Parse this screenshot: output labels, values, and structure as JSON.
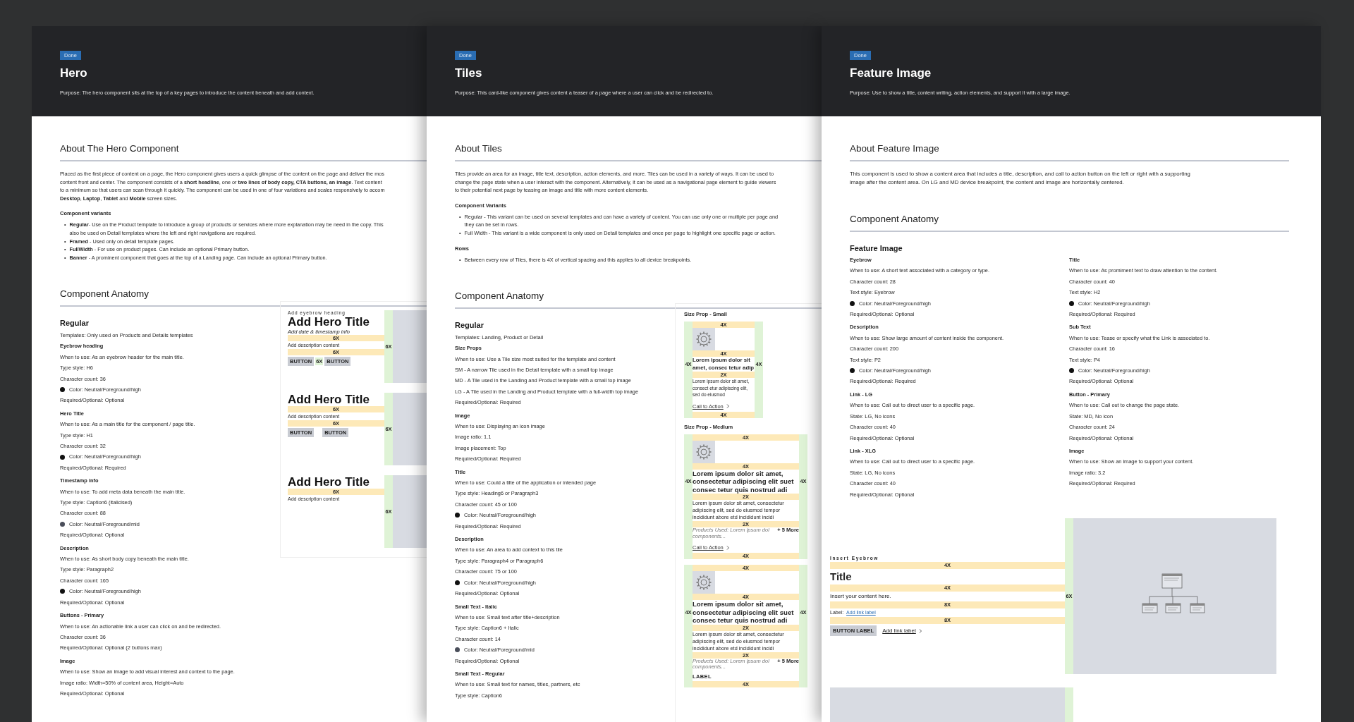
{
  "pages": [
    {
      "status": "Done",
      "title": "Hero",
      "purpose": "Purpose: The hero component sits at the top of a key pages to introduce the content beneath and add context.",
      "about": {
        "heading": "About The Hero Component",
        "lines": [
          "Placed as the first piece of content on a page, the Hero component gives users a quick glimpse of the content on the page and deliver the mos",
          "content front and center. The component consists of a **short headline**, one or **two lines of body copy, CTA buttons, an image**. Text content",
          "to a minimum so that users can scan through it quickly. The component can be used in one of four variations and scales responsively to accom",
          "**Desktop**, **Laptop**, **Tablet** and **Mobile** screen sizes."
        ],
        "groups": [
          {
            "heading": "Component variants",
            "bullets": [
              {
                "marker": "•",
                "lines": [
                  "**Regular**- Use on the Product template to introduce a group of products or services where more explanation may be need in the copy. This",
                  "also be used on Detail templates where the left and right navigations are required."
                ]
              },
              {
                "marker": "•",
                "lines": [
                  "**Framed** - Used only on detail template pages."
                ]
              },
              {
                "marker": "•",
                "lines": [
                  "**FullWidth** - For use on product pages. Can include an optional Primary button."
                ]
              },
              {
                "marker": "•",
                "lines": [
                  "**Banner** - A prominent component that goes at the top of a Landing page. Can include an optional Primary button."
                ]
              }
            ]
          }
        ]
      },
      "anatomy": {
        "heading": "Component Anatomy",
        "subheading": "Regular",
        "templates": "Templates: Only used on Products and Details templates",
        "columns": [
          [
            {
              "label": "Eyebrow heading",
              "lines": [
                {
                  "text": "When to use: As an eyebrow header for the main title."
                },
                {
                  "text": "Type style: H6"
                },
                {
                  "text": "Character count: 36"
                },
                {
                  "text": "Color: Neutral/Foreground/high",
                  "color": "#111111"
                },
                {
                  "text": "Required/Optional: Optional"
                }
              ]
            },
            {
              "label": "Hero Title",
              "lines": [
                {
                  "text": "When to use: As a main title for the component / page title."
                },
                {
                  "text": "Type style: H1"
                },
                {
                  "text": "Character count: 32"
                },
                {
                  "text": "Color: Neutral/Foreground/high",
                  "color": "#111111"
                },
                {
                  "text": "Required/Optional: Required"
                }
              ]
            },
            {
              "label": "Timestamp info",
              "lines": [
                {
                  "text": "When to use: To add meta data beneath the main title."
                },
                {
                  "text": "Type style: Caption6 (italicised)"
                },
                {
                  "text": "Character count: 88"
                },
                {
                  "text": "Color: Neutral/Foreground/mid",
                  "color": "#4a4e5a"
                },
                {
                  "text": "Required/Optional: Optional"
                }
              ]
            },
            {
              "label": "Description",
              "lines": [
                {
                  "text": "When to use: As short body copy beneath the main title."
                },
                {
                  "text": "Type style: Paragraph2"
                },
                {
                  "text": "Character count: 165"
                },
                {
                  "text": "Color: Neutral/Foreground/high",
                  "color": "#111111"
                },
                {
                  "text": "Required/Optional: Optional"
                }
              ]
            },
            {
              "label": "Buttons - Primary",
              "lines": [
                {
                  "text": "When to use: An actionable link a user can click on and be redirected."
                },
                {
                  "text": "Character count: 36"
                },
                {
                  "text": "Required/Optional: Optional (2 buttons max)"
                }
              ]
            },
            {
              "label": "Image",
              "lines": [
                {
                  "text": "When to use: Show an image to add visual interest and context to the page."
                },
                {
                  "text": "Image ratio: Width=50% of content area, Height=Auto"
                },
                {
                  "text": "Required/Optional: Optional"
                }
              ]
            }
          ]
        ]
      },
      "diagram": {
        "kind": "hero_variants",
        "variants": [
          {
            "strip": "6X",
            "rows": [
              {
                "kind": "eyebrow",
                "text": "Add eyebrow heading"
              },
              {
                "kind": "title",
                "text": "Add Hero Title"
              },
              {
                "kind": "timestamp",
                "text": "Add date & timestamp info"
              },
              {
                "kind": "spacer",
                "text": "6X"
              },
              {
                "kind": "description",
                "text": "Add description content"
              },
              {
                "kind": "spacer",
                "text": "6X"
              },
              {
                "kind": "buttons",
                "buttons": [
                  "BUTTON",
                  "BUTTON"
                ],
                "gap": "6X"
              }
            ]
          },
          {
            "strip": "6X",
            "rows": [
              {
                "kind": "title",
                "text": "Add Hero Title"
              },
              {
                "kind": "spacer",
                "text": "6X"
              },
              {
                "kind": "description",
                "text": "Add description content"
              },
              {
                "kind": "spacer",
                "text": "6X"
              },
              {
                "kind": "buttons",
                "buttons": [
                  "BUTTON",
                  "BUTTON"
                ]
              }
            ]
          },
          {
            "strip": "6X",
            "rows": [
              {
                "kind": "title",
                "text": "Add Hero Title"
              },
              {
                "kind": "spacer",
                "text": "6X"
              },
              {
                "kind": "description",
                "text": "Add description content"
              }
            ]
          }
        ]
      }
    },
    {
      "status": "Done",
      "title": "Tiles",
      "purpose": "Purpose: This card-like component gives content a teaser of a page where a user can click and be redirected to.",
      "about": {
        "heading": "About Tiles",
        "lines": [
          "Tiles provide an area for an image, title text, description, action elements, and more. Tiles can be used in a variety of ways. It can be used to",
          "change the page state when a user interact with the component. Alternatively, it can be used as a navigational page element to guide viewers",
          "to their potential next page by teasing an image and title with more content elements."
        ],
        "groups": [
          {
            "heading": "Component Variants",
            "bullets": [
              {
                "marker": "•",
                "lines": [
                  "Regular - This variant can be used on several templates and can have a variety of content. You can use only one or multiple per page and",
                  "they can be set in rows."
                ]
              },
              {
                "marker": "•",
                "lines": [
                  "Full Width - This variant is a wide component is only used on Detail templates and once per page to highlight one specific page or action."
                ]
              }
            ]
          },
          {
            "heading": "Rows",
            "bullets": [
              {
                "marker": "•",
                "lines": [
                  "Between every row of Tiles, there is 4X of vertical spacing and this applies to all device breakpoints."
                ]
              }
            ]
          }
        ]
      },
      "anatomy": {
        "heading": "Component Anatomy",
        "subheading": "Regular",
        "templates": "Templates: Landing, Product or Detail",
        "columns": [
          [
            {
              "label": "Size Props",
              "lines": [
                {
                  "text": "When to use: Use a Tile size most suited for the template and content"
                },
                {
                  "text": "SM - A narrow Tile used in the Detail template with a small top image"
                },
                {
                  "text": "MD - A Tile used in the Landing and Product template with a small top image"
                },
                {
                  "text": "LG - A Tile used in the Landing and Product template with a full-width top image"
                },
                {
                  "text": "Required/Optional: Required"
                }
              ]
            },
            {
              "label": "Image",
              "lines": [
                {
                  "text": "When to use: Displaying an icon image"
                },
                {
                  "text": "Image ratio: 1.1"
                },
                {
                  "text": "Image placement: Top"
                },
                {
                  "text": "Required/Optional: Required"
                }
              ]
            },
            {
              "label": "Title",
              "lines": [
                {
                  "text": "When to use: Could a tilte of the application or intended page"
                },
                {
                  "text": "Type style: Heading6 or Paragraph3"
                },
                {
                  "text": "Character count: 45 or 100"
                },
                {
                  "text": "Color: Neutral/Foreground/high",
                  "color": "#111111"
                },
                {
                  "text": "Required/Optional: Required"
                }
              ]
            },
            {
              "label": "Description",
              "lines": [
                {
                  "text": "When to use: An area to add context to this tile"
                },
                {
                  "text": "Type style: Paragraph4 or Paragraph6"
                },
                {
                  "text": "Character count: 75 or 100"
                },
                {
                  "text": "Color: Neutral/Foreground/high",
                  "color": "#111111"
                },
                {
                  "text": "Required/Optional: Optional"
                }
              ]
            },
            {
              "label": "Small Text - Italic",
              "lines": [
                {
                  "text": "When to use: Small text after title+description"
                },
                {
                  "text": "Type style: Caption6 + Italic"
                },
                {
                  "text": "Character count: 14"
                },
                {
                  "text": "Color: Neutral/Foreground/mid",
                  "color": "#4a4e5a"
                },
                {
                  "text": "Required/Optional: Optional"
                }
              ]
            },
            {
              "label": "Small Text - Regular",
              "lines": [
                {
                  "text": "When to use: Small text for names, titles, partners, etc"
                },
                {
                  "text": "Type style: Caption6"
                }
              ]
            }
          ]
        ]
      },
      "diagram": {
        "kind": "tile_sizes",
        "sizes": [
          {
            "heading": "Size Prop - Small",
            "rows": [
              {
                "kind": "spacer",
                "text": "4X"
              },
              {
                "kind": "image"
              },
              {
                "kind": "spacer",
                "text": "4X"
              },
              {
                "kind": "title",
                "text": "Lorem ipsum dolor sit amet, consec tetur adip",
                "side_labels": [
                  "4X",
                  "4X"
                ]
              },
              {
                "kind": "spacer",
                "text": "2X"
              },
              {
                "kind": "description",
                "text": "Lorem ipsum dolor sit amet, consect etur adipiscing elit, sed do eiusmod"
              },
              {
                "kind": "cta",
                "text": "Call to Action"
              },
              {
                "kind": "spacer",
                "text": "4X"
              }
            ]
          },
          {
            "heading": "Size Prop - Medium",
            "rows": [
              {
                "kind": "spacer",
                "text": "4X"
              },
              {
                "kind": "image"
              },
              {
                "kind": "spacer",
                "text": "4X"
              },
              {
                "kind": "title",
                "text": "Lorem ipsum dolor sit amet, consectetur adipiscing elit suet consec tetur quis nostrud adi",
                "side_labels": [
                  "4X",
                  "4X"
                ]
              },
              {
                "kind": "spacer",
                "text": "2X"
              },
              {
                "kind": "description",
                "text": "Lorem ipsum dolor sit amet, consectetur adipiscing elit, sed do eiusmod tempor incididunt abore etd incididunt incidi"
              },
              {
                "kind": "spacer",
                "text": "2X"
              },
              {
                "kind": "products",
                "text": "Products Used:  Lorem ipsum dol components...",
                "more": "+ 5 More"
              },
              {
                "kind": "cta",
                "text": "Call to Action"
              },
              {
                "kind": "spacer",
                "text": "4X"
              }
            ]
          },
          {
            "rows": [
              {
                "kind": "spacer",
                "text": "4X"
              },
              {
                "kind": "image"
              },
              {
                "kind": "spacer",
                "text": "4X"
              },
              {
                "kind": "title",
                "text": "Lorem ipsum dolor sit amet, consectetur adipiscing elit suet consec tetur quis nostrud adi",
                "side_labels": [
                  "4X",
                  "4X"
                ]
              },
              {
                "kind": "spacer",
                "text": "2X"
              },
              {
                "kind": "description",
                "text": "Lorem ipsum dolor sit amet, consectetur adipiscing elit, sed do eiusmod tempor incididunt abore etd incididunt incidi"
              },
              {
                "kind": "spacer",
                "text": "2X"
              },
              {
                "kind": "products",
                "text": "Products Used:  Lorem ipsum dol components...",
                "more": "+ 5 More"
              },
              {
                "kind": "label",
                "text": "LABEL"
              },
              {
                "kind": "spacer",
                "text": "4X"
              }
            ]
          }
        ]
      }
    },
    {
      "status": "Done",
      "title": "Feature Image",
      "purpose": "Purpose: Use to show a title, content writing, action elements, and support it with a large image.",
      "about": {
        "heading": "About Feature Image",
        "lines": [
          "This component is used to show a content area that includes a title, description, and call to action button on the left or right with a supporting",
          "image after the content area. On LG and MD device breakpoint, the content and image are horizontally centered."
        ]
      },
      "anatomy": {
        "heading": "Component Anatomy",
        "subheading": "Feature Image",
        "columns": [
          [
            {
              "label": "Eyebrow",
              "lines": [
                {
                  "text": "When to use: A short text associated with a category or type."
                },
                {
                  "text": "Character count: 28"
                },
                {
                  "text": "Text style: Eyebrow"
                },
                {
                  "text": "Color: Neutral/Foreground/high",
                  "color": "#111111"
                },
                {
                  "text": "Required/Optional: Optional"
                }
              ]
            },
            {
              "label": "Description",
              "lines": [
                {
                  "text": "When to use: Show large amount of content inside the component."
                },
                {
                  "text": "Character count: 200"
                },
                {
                  "text": "Text style: P2"
                },
                {
                  "text": "Color: Neutral/Foreground/high",
                  "color": "#111111"
                },
                {
                  "text": "Required/Optional: Required"
                }
              ]
            },
            {
              "label": "Link - LG",
              "lines": [
                {
                  "text": "When to use: Call out to direct user to a specific page."
                },
                {
                  "text": "State: LG, No icons"
                },
                {
                  "text": "Character count: 40"
                },
                {
                  "text": "Required/Optional: Optional"
                }
              ]
            },
            {
              "label": "Link - XLG",
              "lines": [
                {
                  "text": "When to use: Call out to direct user to a specific page."
                },
                {
                  "text": "State: LG, No icons"
                },
                {
                  "text": "Character count: 40"
                },
                {
                  "text": "Required/Optional: Optional"
                }
              ]
            }
          ],
          [
            {
              "label": "Title",
              "lines": [
                {
                  "text": "When to use: As promiment text to draw attention to the content."
                },
                {
                  "text": "Character count: 40"
                },
                {
                  "text": "Text style: H2"
                },
                {
                  "text": "Color: Neutral/Foreground/high",
                  "color": "#111111"
                },
                {
                  "text": "Required/Optional: Required"
                }
              ]
            },
            {
              "label": "Sub Text",
              "lines": [
                {
                  "text": "When to use: Tease or specify what the Link is associated to."
                },
                {
                  "text": "Character count: 16"
                },
                {
                  "text": "Text style: P4"
                },
                {
                  "text": "Color: Neutral/Foreground/high",
                  "color": "#111111"
                },
                {
                  "text": "Required/Optional: Optional"
                }
              ]
            },
            {
              "label": "Button - Primary",
              "lines": [
                {
                  "text": "When to use: Call out to change the page state."
                },
                {
                  "text": "State: MD, No icon"
                },
                {
                  "text": "Character count: 24"
                },
                {
                  "text": "Required/Optional: Optional"
                }
              ]
            },
            {
              "label": "Image",
              "lines": [
                {
                  "text": "When to use: Show an image to support your content."
                },
                {
                  "text": "Image ratio: 3.2"
                },
                {
                  "text": "Required/Optional: Required"
                }
              ]
            }
          ]
        ]
      },
      "diagram": {
        "kind": "feature_image",
        "strip": "6X",
        "rows": [
          {
            "kind": "eyebrow",
            "text": "Insert Eyebrow"
          },
          {
            "kind": "spacer",
            "text": "4X"
          },
          {
            "kind": "title",
            "text": "Title"
          },
          {
            "kind": "spacer",
            "text": "4X"
          },
          {
            "kind": "description",
            "text": "Insert your content here."
          },
          {
            "kind": "spacer",
            "text": "8X"
          },
          {
            "kind": "link_line",
            "label": "Label:",
            "link": "Add link label"
          },
          {
            "kind": "spacer",
            "text": "8X"
          },
          {
            "kind": "actions",
            "button": "BUTTON LABEL",
            "link": "Add link label"
          }
        ]
      }
    }
  ]
}
